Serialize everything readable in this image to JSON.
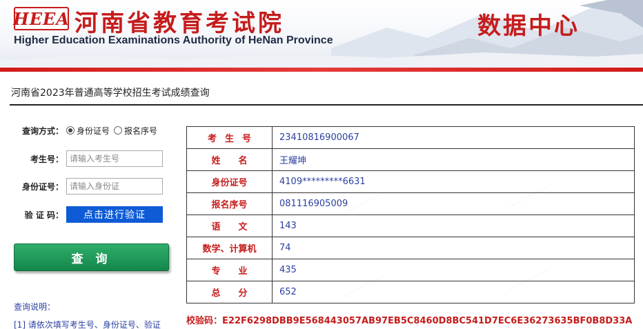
{
  "header": {
    "logo_text": "HEEA",
    "org_name": "河南省教育考试院",
    "org_name_en": "Higher Education Examinations Authority of HeNan Province",
    "data_center": "数据中心"
  },
  "page_title": "河南省2023年普通高等学校招生考试成绩查询",
  "form": {
    "query_mode_label": "查询方式：",
    "query_mode_options": [
      {
        "label": "身份证号",
        "checked": true
      },
      {
        "label": "报名序号",
        "checked": false
      }
    ],
    "exam_no_label": "考生号：",
    "exam_no_placeholder": "请输入考生号",
    "id_no_label": "身份证号：",
    "id_no_placeholder": "请输入身份证",
    "verify_label": "验 证 码：",
    "verify_button": "点击进行验证",
    "query_button": "查 询"
  },
  "help": {
    "title": "查询说明：",
    "items": [
      "[1] 请依次填写考生号、身份证号、验证"
    ]
  },
  "results": {
    "rows": [
      {
        "key": "考生号",
        "value": "23410816900067"
      },
      {
        "key": "姓名",
        "value": "王耀坤"
      },
      {
        "key": "身份证号",
        "value": "4109*********6631"
      },
      {
        "key": "报名序号",
        "value": "081116905009"
      },
      {
        "key": "语文",
        "value": "143"
      },
      {
        "key": "数学、计算机",
        "value": "74"
      },
      {
        "key": "专业",
        "value": "435"
      },
      {
        "key": "总分",
        "value": "652"
      }
    ]
  },
  "checksum_label": "校验码：",
  "checksum_value": "E22F6298DBB9E568443057AB97EB5C8460D8BC541D7EC6E36273635BF0B8D33A",
  "colors": {
    "brand_red": "#c61c1c",
    "value_blue": "#2a3fa0",
    "verify_blue": "#0d5bd6",
    "query_green": "#14874b"
  }
}
